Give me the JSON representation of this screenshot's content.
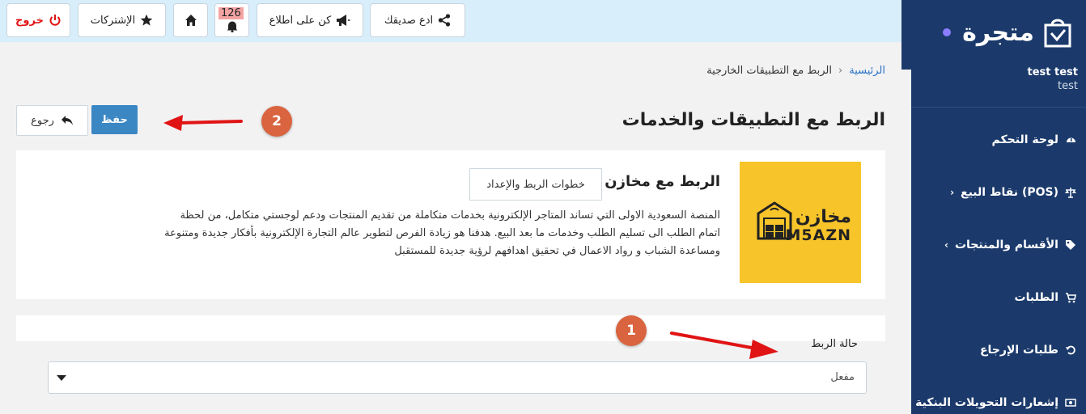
{
  "sidebar": {
    "logo": "متجرة",
    "user_name": "test test",
    "user_sub": "test",
    "items": [
      {
        "label": "لوحة التحكم",
        "icon": "dashboard-icon"
      },
      {
        "label": "نقاط البيع (POS)",
        "icon": "scale-icon",
        "chevron": "›"
      },
      {
        "label": "الأقسام والمنتجات",
        "icon": "tag-icon",
        "chevron": "‹"
      },
      {
        "label": "الطلبات",
        "icon": "cart-icon"
      },
      {
        "label": "طلبات الإرجاع",
        "icon": "undo-icon"
      },
      {
        "label": "إشعارات التحويلات البنكية",
        "icon": "money-icon"
      }
    ]
  },
  "topbar": {
    "invite_label": "ادع صديقك",
    "stay_informed_label": "كن على اطلاع",
    "notifications_count": "126",
    "subscriptions_label": "الإشتركات",
    "logout_label": "خروج"
  },
  "breadcrumb": {
    "home": "الرئيسية",
    "separator": "›",
    "current": "الربط مع التطبيقات الخارجية"
  },
  "page": {
    "title": "الربط مع التطبيقات والخدمات",
    "save_label": "حفظ",
    "back_label": "رجوع"
  },
  "annotations": {
    "step_1": "1",
    "step_2": "2",
    "accent_color": "#d9643f",
    "arrow_color": "#e01414"
  },
  "app": {
    "title": "الربط مع مخازن",
    "steps_button": "خطوات الربط والإعداد",
    "logo_ar": "مخازن",
    "logo_en": "M5AZN",
    "logo_bg": "#f7c42a",
    "description": "المنصة السعودية الاولى التي تساند المتاجر الإلكترونية بخدمات متكاملة من تقديم المنتجات ودعم لوجستي متكامل، من لحظة اتمام الطلب الى تسليم الطلب وخدمات ما بعد البيع. هدفنا هو زيادة الفرص لتطوير عالم التجارة الإلكترونية بأفكار جديدة ومتنوعة ومساعدة الشباب و رواد الاعمال في تحقيق اهدافهم لرؤية جديدة للمستقبل"
  },
  "status": {
    "label": "حالة الربط",
    "value": "مفعل"
  },
  "colors": {
    "sidebar_bg": "#1b3a6b",
    "topbar_bg": "#d8eefa",
    "primary": "#3a87c4",
    "link": "#2a72c7",
    "logout": "#e01414"
  }
}
